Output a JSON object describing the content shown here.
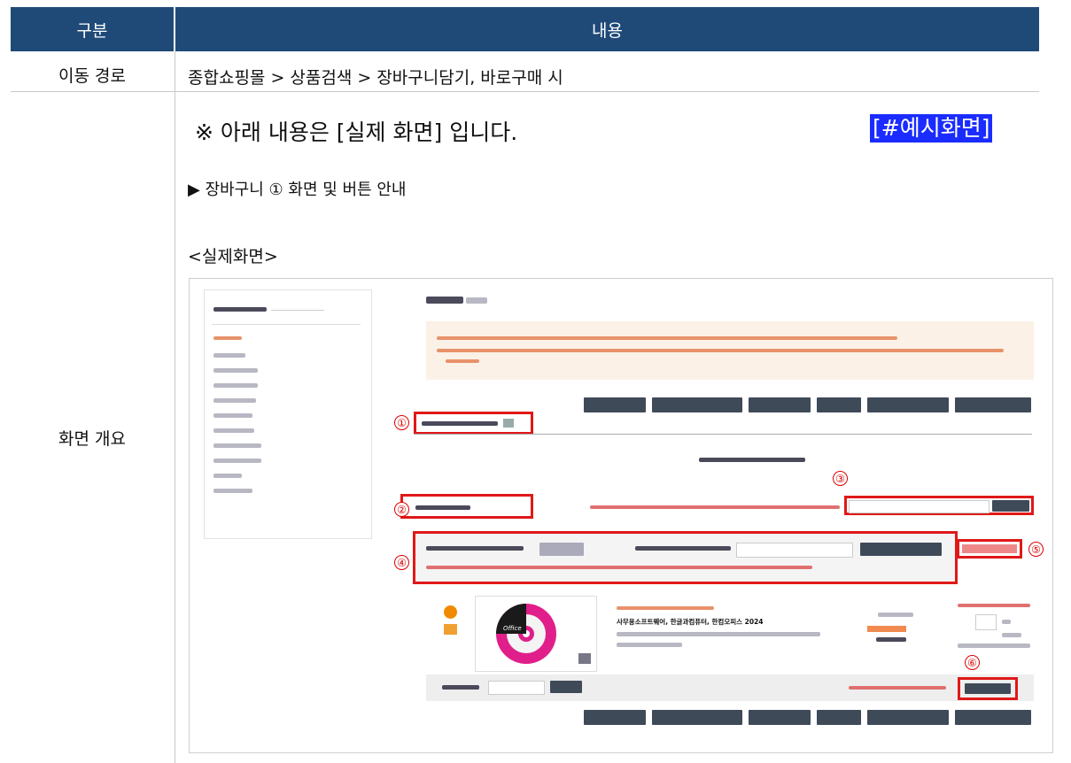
{
  "table": {
    "header": {
      "col1": "구분",
      "col2": "내용"
    },
    "row1": {
      "label": "이동 경로",
      "value": "종합쇼핑몰 > 상품검색 > 장바구니담기, 바로구매 시"
    },
    "row2": {
      "label": "화면 개요",
      "note": "※ 아래 내용은 [실제 화면] 입니다.",
      "example_link": "[#예시화면]",
      "section_title": "▶ 장바구니 ① 화면 및 버튼 안내",
      "screen_caption": "<실제화면>"
    }
  },
  "screenshot": {
    "product_name": "사무용소프트웨어, 한글과컴퓨터, 한컴오피스 2024",
    "product_thumb_label": "Office",
    "markers": [
      "①",
      "②",
      "③",
      "④",
      "⑤",
      "⑥"
    ]
  },
  "colors": {
    "header_bg": "#1f4a78",
    "link_bg": "#1a2cff",
    "marker": "#e01818"
  }
}
